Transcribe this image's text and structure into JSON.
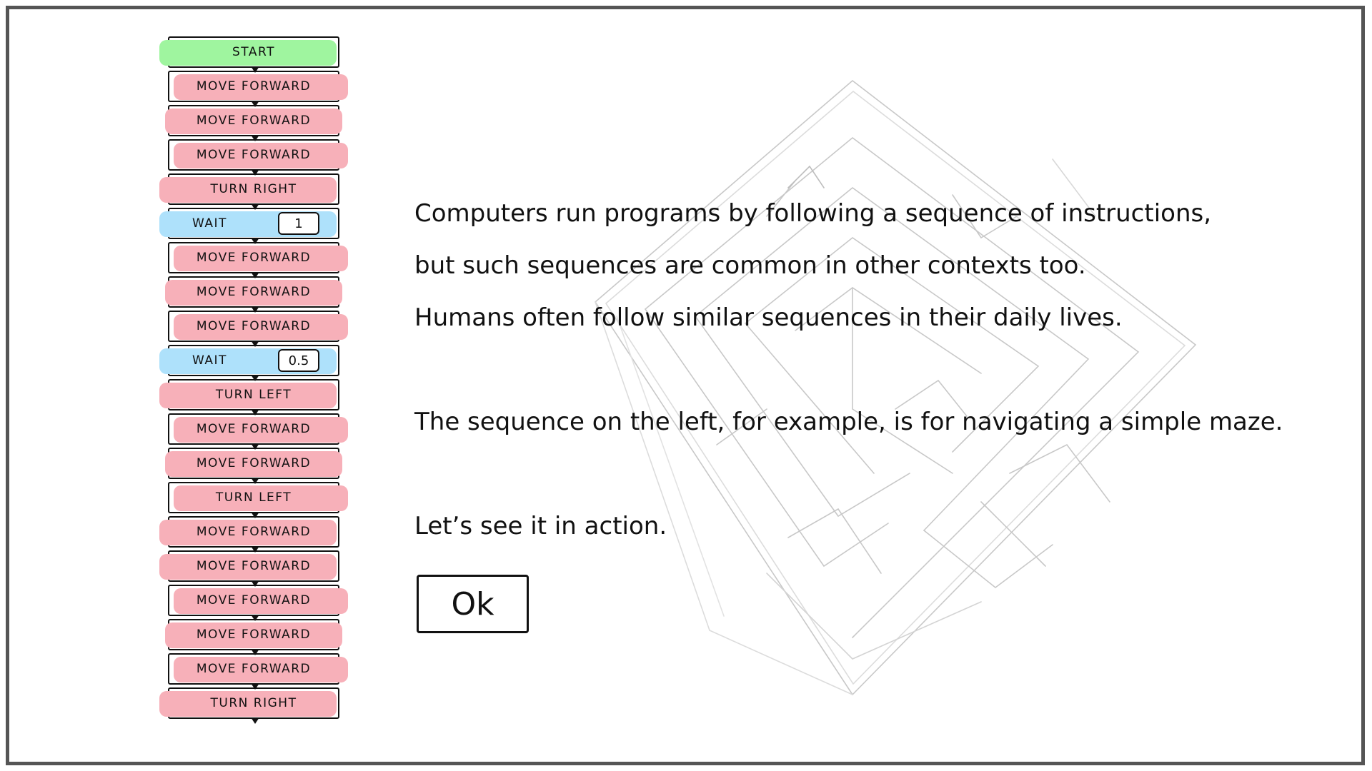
{
  "colors": {
    "start": "#9ff59f",
    "action": "#f7b0b9",
    "wait": "#aee1fb",
    "frame": "#555555",
    "maze_lines": "#c8c8c8"
  },
  "program": {
    "blocks": [
      {
        "type": "start",
        "label": "START"
      },
      {
        "type": "action",
        "label": "MOVE FORWARD"
      },
      {
        "type": "action",
        "label": "MOVE FORWARD"
      },
      {
        "type": "action",
        "label": "MOVE FORWARD"
      },
      {
        "type": "action",
        "label": "TURN RIGHT"
      },
      {
        "type": "wait",
        "label": "WAIT",
        "value": "1"
      },
      {
        "type": "action",
        "label": "MOVE FORWARD"
      },
      {
        "type": "action",
        "label": "MOVE FORWARD"
      },
      {
        "type": "action",
        "label": "MOVE FORWARD"
      },
      {
        "type": "wait",
        "label": "WAIT",
        "value": "0.5"
      },
      {
        "type": "action",
        "label": "TURN LEFT"
      },
      {
        "type": "action",
        "label": "MOVE FORWARD"
      },
      {
        "type": "action",
        "label": "MOVE FORWARD"
      },
      {
        "type": "action",
        "label": "TURN LEFT"
      },
      {
        "type": "action",
        "label": "MOVE FORWARD"
      },
      {
        "type": "action",
        "label": "MOVE FORWARD"
      },
      {
        "type": "action",
        "label": "MOVE FORWARD"
      },
      {
        "type": "action",
        "label": "MOVE FORWARD"
      },
      {
        "type": "action",
        "label": "MOVE FORWARD"
      },
      {
        "type": "action",
        "label": "TURN RIGHT"
      }
    ]
  },
  "intro": {
    "line1": "Computers run programs by following a sequence of instructions,",
    "line2": "but such sequences are common in other contexts too.",
    "line3": "Humans often follow similar sequences in their daily lives.",
    "line4": "The sequence on the left, for example, is for navigating a simple maze.",
    "line5": "Let’s see it in action."
  },
  "ok_button": {
    "label": "Ok"
  }
}
